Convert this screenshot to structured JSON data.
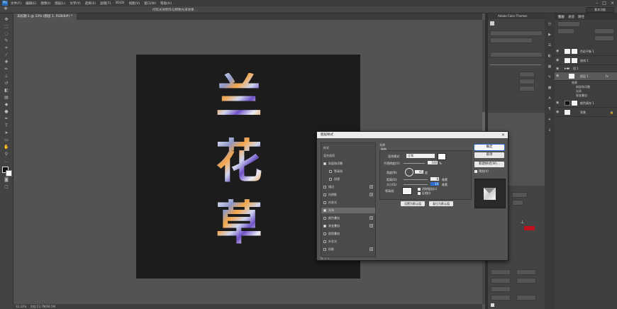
{
  "menubar": {
    "items": [
      "文件(F)",
      "编辑(E)",
      "图像(I)",
      "图层(L)",
      "文字(Y)",
      "选择(S)",
      "滤镜(T)",
      "3D(D)",
      "视图(V)",
      "窗口(W)",
      "帮助(H)"
    ],
    "logo": "Ps"
  },
  "optionsbar": {
    "document_title": "闪烁光效制作与精致光泽效果…",
    "workspace": "基本功能"
  },
  "tabbar": {
    "active_tab": "未标题-1 @ 33% (图层 1, RGB/8#) *"
  },
  "canvas": {
    "text_chars": [
      "兰",
      "花",
      "草"
    ]
  },
  "statusbar": {
    "zoom": "33.33%",
    "doc_info": "文档:23.7M/68.5M"
  },
  "themes_panel": {
    "title": "Adobe Color Themes"
  },
  "layers_panel": {
    "tabs": [
      "图层",
      "通道",
      "路径"
    ],
    "active_tab_index": 0,
    "layers": [
      {
        "name": "色彩平衡 1",
        "thumb": "white",
        "has_mask": true
      },
      {
        "name": "曲线 1",
        "thumb": "white",
        "has_mask": true
      },
      {
        "name": "组 1",
        "thumb": "group",
        "has_mask": false
      },
      {
        "name": "图层 1",
        "thumb": "white",
        "has_mask": false,
        "selected": true
      },
      {
        "name": "颜色填充 1",
        "thumb": "black",
        "has_mask": true
      },
      {
        "name": "背景",
        "thumb": "white",
        "has_mask": false
      }
    ],
    "effects_label": "效果",
    "effects": [
      "斜面和浮雕",
      "光泽",
      "渐变叠加"
    ]
  },
  "dialog": {
    "title": "图层样式",
    "close": "×",
    "style_list": [
      {
        "label": "样式",
        "checkbox": false,
        "checked": false,
        "plus": false,
        "indent": 0
      },
      {
        "label": "混合选项",
        "checkbox": false,
        "checked": false,
        "plus": false,
        "indent": 0
      },
      {
        "label": "斜面和浮雕",
        "checkbox": true,
        "checked": true,
        "plus": false,
        "indent": 0
      },
      {
        "label": "等高线",
        "checkbox": true,
        "checked": false,
        "plus": false,
        "indent": 1
      },
      {
        "label": "纹理",
        "checkbox": true,
        "checked": false,
        "plus": false,
        "indent": 1
      },
      {
        "label": "描边",
        "checkbox": true,
        "checked": false,
        "plus": true,
        "indent": 0
      },
      {
        "label": "内阴影",
        "checkbox": true,
        "checked": false,
        "plus": true,
        "indent": 0
      },
      {
        "label": "内发光",
        "checkbox": true,
        "checked": false,
        "plus": false,
        "indent": 0
      },
      {
        "label": "光泽",
        "checkbox": true,
        "checked": true,
        "plus": false,
        "indent": 0,
        "selected": true
      },
      {
        "label": "颜色叠加",
        "checkbox": true,
        "checked": false,
        "plus": true,
        "indent": 0
      },
      {
        "label": "渐变叠加",
        "checkbox": true,
        "checked": true,
        "plus": true,
        "indent": 0
      },
      {
        "label": "图案叠加",
        "checkbox": true,
        "checked": false,
        "plus": false,
        "indent": 0
      },
      {
        "label": "外发光",
        "checkbox": true,
        "checked": false,
        "plus": false,
        "indent": 0
      },
      {
        "label": "投影",
        "checkbox": true,
        "checked": false,
        "plus": true,
        "indent": 0
      }
    ],
    "list_footer": "fx  ⇧  ⇩",
    "gloss": {
      "section_title": "光泽",
      "group_title": "结构",
      "blend_mode_label": "混合模式:",
      "blend_mode_value": "正常",
      "opacity_label": "不透明度(O):",
      "opacity_value": "100",
      "percent": "%",
      "angle_label": "角度(N):",
      "angle_value": "45",
      "degree": "度",
      "distance_label": "距离(D):",
      "distance_value": "8",
      "size_label": "大小(S):",
      "size_value": "14",
      "pixel": "像素",
      "contour_label": "等高线:",
      "antialias_label": "消除锯齿(L)",
      "invert_label": "反相(I)",
      "set_default": "设置为默认值",
      "reset_default": "复位为默认值"
    },
    "buttons": {
      "ok": "确定",
      "cancel": "取消",
      "new_style": "新建样式(W)...",
      "preview_label": "预览(V)"
    }
  }
}
